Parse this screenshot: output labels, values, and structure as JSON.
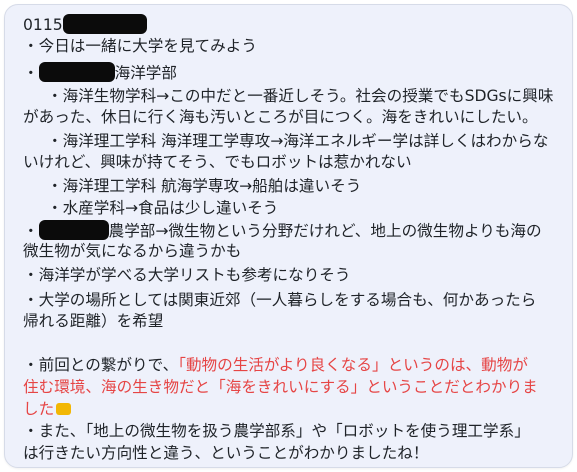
{
  "message": {
    "id_prefix": "0115",
    "l1": "・今日は一緒に大学を見てみよう",
    "l2_prefix": "・",
    "l2_suffix": "海洋学部",
    "l3": "・海洋生物学科→この中だと一番近しそう。社会の授業でもSDGsに興味",
    "l4": "があった、休日に行く海も汚いところが目につく。海をきれいにしたい。",
    "l5": "・海洋理工学科 海洋理工学専攻→海洋エネルギー学は詳しくはわからな",
    "l6": "いけれど、興味が持てそう、でもロボットは惹かれない",
    "l7": "・海洋理工学科 航海学専攻→船舶は違いそう",
    "l8": "・水産学科→食品は少し違いそう",
    "l9_prefix": "・",
    "l9_suffix": "農学部→微生物という分野だけれど、地上の微生物よりも海の",
    "l10": "微生物が気になるから違うかも",
    "l11": "・海洋学が学べる大学リストも参考になりそう",
    "l12": "・大学の場所としては関東近郊（一人暮らしをする場合も、何かあったら",
    "l13": "帰れる距離）を希望",
    "l14_black": "・前回との繋がりで、",
    "l14_red": "「動物の生活がより良くなる」というのは、動物が",
    "l15": "住む環境、海の生き物だと「海をきれいにする」ということだとわかりま",
    "l16": "した",
    "l17": "・また、「地上の微生物を扱う農学部系」や「ロボットを使う理工学系」",
    "l18": "は行きたい方向性と違う、ということがわかりましたね！"
  },
  "colors": {
    "bubble_bg": "#eef1fb",
    "text": "#1f2328",
    "highlight_red": "#e64545",
    "redaction": "#0b0b0b"
  },
  "icons": {
    "heart": "yellow-heart-emoji"
  }
}
